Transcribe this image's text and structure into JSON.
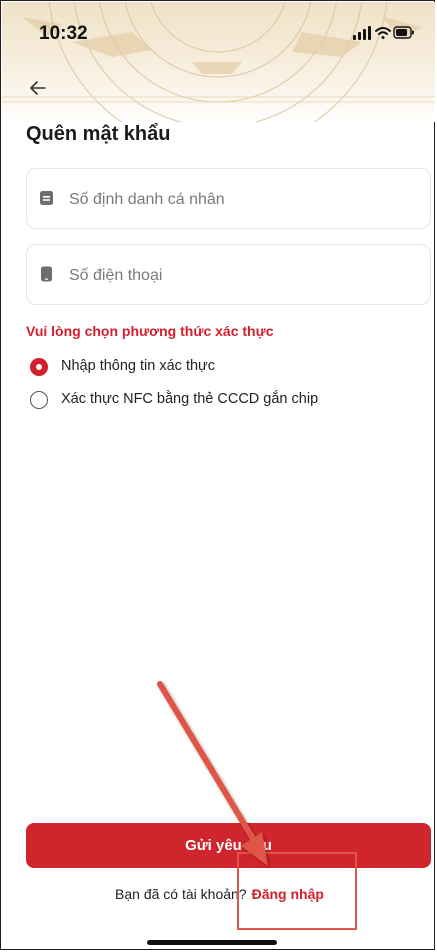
{
  "status_bar": {
    "time": "10:32",
    "icons": [
      "signal-icon",
      "wifi-icon",
      "battery-icon"
    ]
  },
  "nav": {
    "back_icon": "arrow-left-icon"
  },
  "title": "Quên mật khẩu",
  "fields": {
    "id_number": {
      "placeholder": "Số định danh cá nhân",
      "value": "",
      "icon": "id-card-icon"
    },
    "phone": {
      "placeholder": "Số điện thoại",
      "value": "",
      "icon": "phone-icon"
    }
  },
  "verification": {
    "label": "Vui lòng chọn phương thức xác thực",
    "options": [
      {
        "label": "Nhập thông tin xác thực",
        "selected": true
      },
      {
        "label": "Xác thực NFC bằng thẻ CCCD gắn chip",
        "selected": false
      }
    ]
  },
  "submit_label": "Gửi yêu cầu",
  "login_prompt": {
    "text": "Bạn đã có tài khoản?",
    "link": "Đăng nhập"
  },
  "colors": {
    "brand_red": "#d0252c",
    "annotation_red": "#e05545",
    "header_tint": "#efe2c8"
  }
}
